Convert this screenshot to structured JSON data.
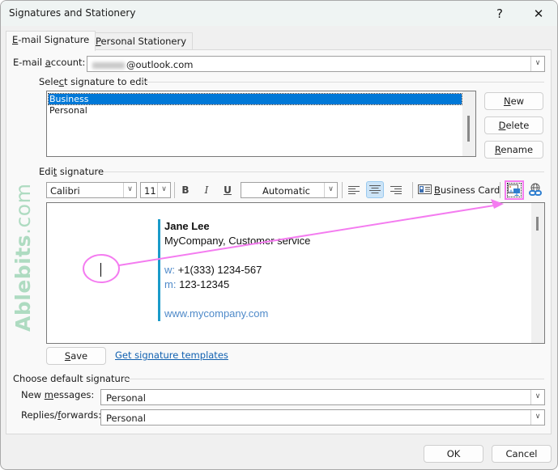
{
  "window": {
    "title": "Signatures and Stationery",
    "help_label": "?",
    "close_label": "✕"
  },
  "tabs": [
    {
      "label_pre": "",
      "label_ul": "E",
      "label_post": "-mail Signature",
      "active": true
    },
    {
      "label_pre": "",
      "label_ul": "P",
      "label_post": "ersonal Stationery",
      "active": false
    }
  ],
  "account": {
    "label_pre": "E-mail ",
    "label_ul": "a",
    "label_post": "ccount:",
    "value_suffix": "@outlook.com"
  },
  "select_signature": {
    "label_pre": "Sele",
    "label_ul": "c",
    "label_post": "t signature to edit",
    "items": [
      {
        "label": "Business",
        "selected": true
      },
      {
        "label": "Personal",
        "selected": false
      }
    ],
    "buttons": [
      {
        "ul": "N",
        "rest": "ew"
      },
      {
        "ul": "D",
        "rest": "elete"
      },
      {
        "ul": "R",
        "rest": "ename"
      }
    ]
  },
  "edit_signature": {
    "label_pre": "Edi",
    "label_ul": "t",
    "label_post": " signature",
    "toolbar": {
      "font": "Calibri",
      "size": "11",
      "bold": "B",
      "italic": "I",
      "underline": "U",
      "color": "Automatic",
      "business_card_ul": "B",
      "business_card_rest": "usiness Card",
      "alignment_active": "center"
    },
    "content": {
      "name": "Jane Lee",
      "company": "MyCompany, Customer service",
      "work_label": "w:",
      "work_phone": "+1(333) 1234-567",
      "mobile_label": "m:",
      "mobile_phone": "123-12345",
      "website": "www.mycompany.com"
    },
    "save_ul": "S",
    "save_rest": "ave",
    "templates_link": "Get signature templates"
  },
  "default_signature": {
    "label": "Choose default signature",
    "new_messages_pre": "New ",
    "new_messages_ul": "m",
    "new_messages_post": "essages:",
    "new_messages_value": "Personal",
    "replies_pre": "Replies/",
    "replies_ul": "f",
    "replies_post": "orwards:",
    "replies_value": "Personal"
  },
  "footer": {
    "ok": "OK",
    "cancel": "Cancel"
  },
  "watermark": {
    "bold": "Ablebits",
    "light": ".com"
  },
  "colors": {
    "selection": "#0078d7",
    "signature_bar": "#1a9bc9",
    "annotation": "#f47cf0",
    "link": "#1060b0"
  }
}
